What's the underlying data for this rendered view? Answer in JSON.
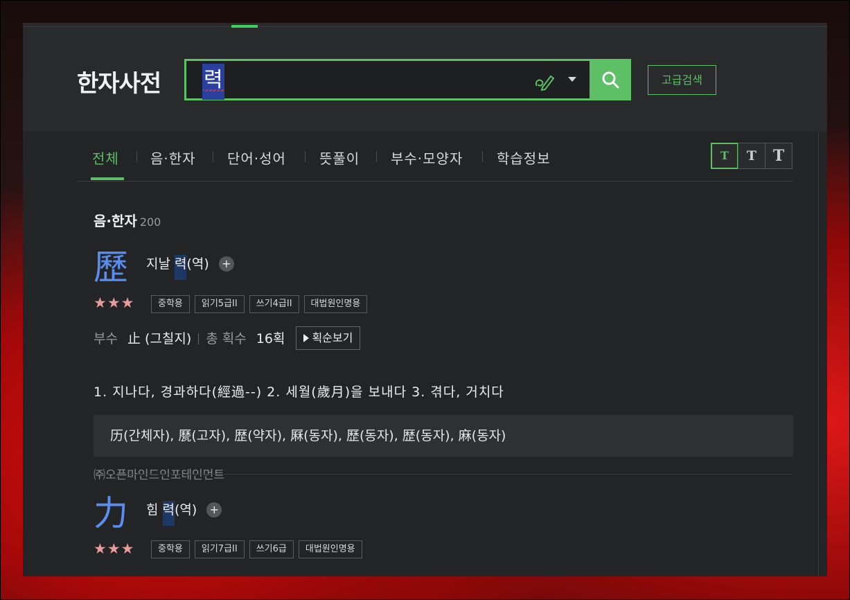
{
  "header": {
    "logo": "한자사전",
    "query": "력",
    "advanced_label": "고급검색"
  },
  "tabs": [
    {
      "label": "전체",
      "active": true
    },
    {
      "label": "음·한자"
    },
    {
      "label": "단어·성어"
    },
    {
      "label": "뜻풀이"
    },
    {
      "label": "부수·모양자"
    },
    {
      "label": "학습정보"
    }
  ],
  "text_size": [
    "T",
    "T",
    "T"
  ],
  "section": {
    "title": "음·한자",
    "count": "200"
  },
  "entries": [
    {
      "hanja": "歷",
      "reading_prefix": "지날 ",
      "reading_hl": "력",
      "reading_suffix": "(역)",
      "plus": "+",
      "stars": "★★★",
      "badges": [
        "중학용",
        "읽기5급II",
        "쓰기4급II",
        "대법원인명용"
      ],
      "radical_label": "부수",
      "radical_value": "止 (그칠지)",
      "strokes_label": "총 획수",
      "strokes_value": "16획",
      "stroke_button": "획순보기",
      "meaning": "1. 지나다, 경과하다(經過--)  2. 세월(歲月)을 보내다  3. 겪다, 거치다",
      "variants": "历(간체자), 㽁(고자), 歴(약자), 厤(동자), 歷(동자), 歴(동자), 麻(동자)",
      "source": "㈜오픈마인드인포테인먼트"
    },
    {
      "hanja": "力",
      "reading_prefix": "힘 ",
      "reading_hl": "력",
      "reading_suffix": "(역)",
      "plus": "+",
      "stars": "★★★",
      "badges": [
        "중학용",
        "읽기7급II",
        "쓰기6급",
        "대법원인명용"
      ]
    }
  ]
}
